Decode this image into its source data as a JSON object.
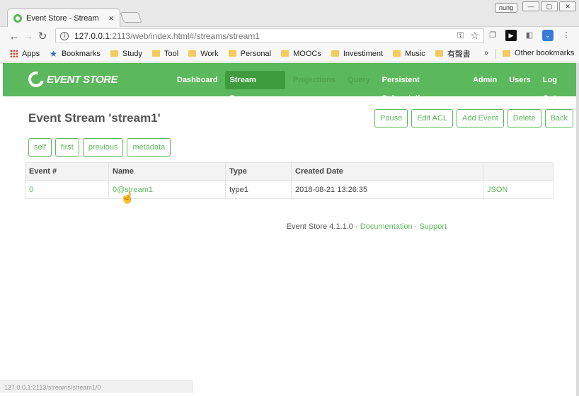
{
  "browser": {
    "tab_title": "Event Store - Stream",
    "tab_close": "×",
    "user_chip": "nung",
    "window_buttons": [
      "—",
      "▢",
      "✕"
    ],
    "url_host": "127.0.0.1",
    "url_rest": ":2113/web/index.html#/streams/stream1",
    "status_url": "127.0.0.1:2113/streams/stream1/0"
  },
  "bookmarks": {
    "items": [
      "Apps",
      "Bookmarks",
      "Study",
      "Tool",
      "Work",
      "Personal",
      "MOOCs",
      "Investiment",
      "Music",
      "有聲書"
    ],
    "more": "»",
    "other": "Other bookmarks"
  },
  "app": {
    "logo_text": "EVENT STORE",
    "nav": [
      "Dashboard",
      "Stream Browser",
      "Projections",
      "Query",
      "Persistent Subscriptions",
      "Admin",
      "Users",
      "Log Out"
    ],
    "active_nav": "Stream Browser"
  },
  "stream": {
    "title": "Event Stream 'stream1'",
    "actions": [
      "Pause",
      "Edit ACL",
      "Add Event",
      "Delete",
      "Back"
    ],
    "links": [
      "self",
      "first",
      "previous",
      "metadata"
    ]
  },
  "table": {
    "headers": [
      "Event #",
      "Name",
      "Type",
      "Created Date",
      ""
    ],
    "rows": [
      {
        "number": "0",
        "name": "0@stream1",
        "type": "type1",
        "created": "2018-08-21 13:26:35",
        "format": "JSON"
      }
    ]
  },
  "footer": {
    "version": "Event Store 4.1.1.0",
    "sep": " · ",
    "documentation": "Documentation",
    "support": "Support"
  },
  "colors": {
    "brand": "#5cb85c",
    "brand_dark": "#3e9b3e"
  }
}
